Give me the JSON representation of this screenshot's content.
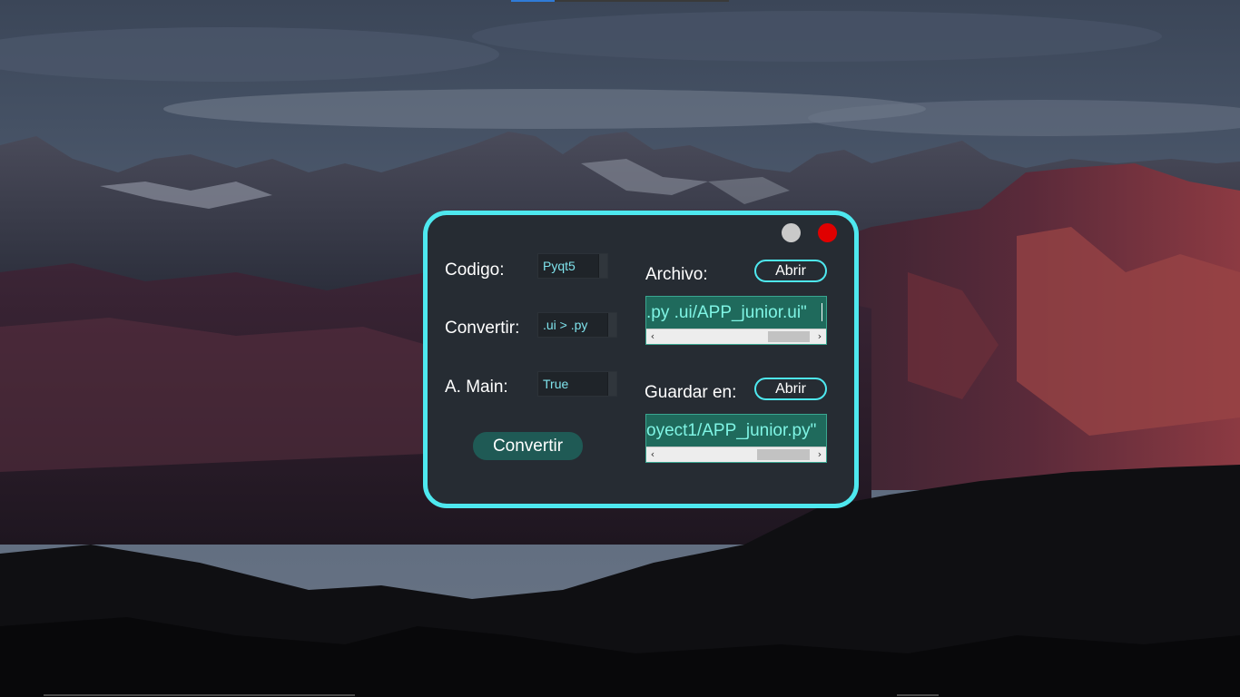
{
  "dialog": {
    "minimize_label": "",
    "close_label": "",
    "codigo_label": "Codigo:",
    "codigo_value": "Pyqt5",
    "convertir_label": "Convertir:",
    "convertir_value": ".ui > .py",
    "amain_label": "A. Main:",
    "amain_value": "True",
    "convert_button": "Convertir",
    "archivo_label": "Archivo:",
    "archivo_button": "Abrir",
    "archivo_path": ".py .ui/APP_junior.ui\"",
    "guardar_label": "Guardar en:",
    "guardar_button": "Abrir",
    "guardar_path": "oyect1/APP_junior.py\""
  },
  "scroll": {
    "left_arrow": "‹",
    "right_arrow": "›"
  },
  "colors": {
    "accent": "#4ee8ef",
    "panel": "#262c33",
    "close": "#e00000",
    "minimize": "#c9c9c9",
    "path_bg": "#1f6a5c",
    "button_bg": "#1f5a55"
  }
}
